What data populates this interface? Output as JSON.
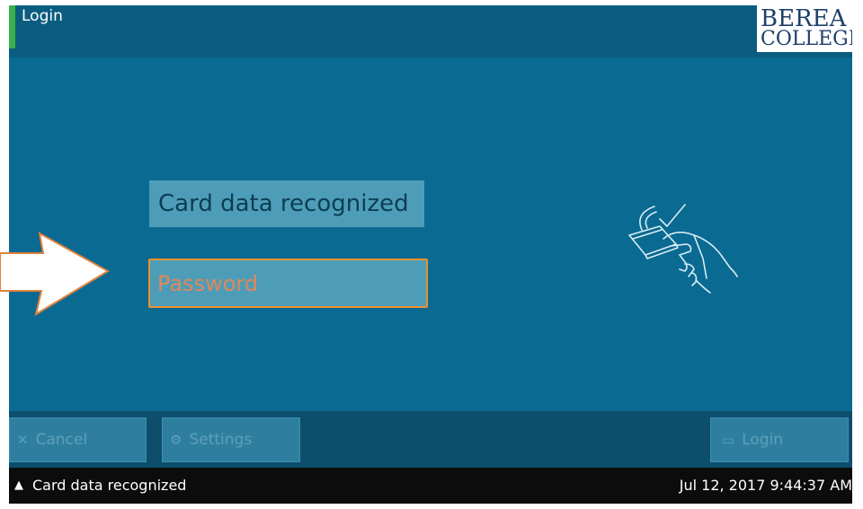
{
  "window": {
    "title": "Login",
    "logo_line1": "BEREA",
    "logo_line2": "COLLEGE"
  },
  "form": {
    "card_status": "Card data recognized",
    "password": {
      "placeholder": "Password",
      "value": ""
    }
  },
  "buttons": {
    "cancel": "Cancel",
    "settings": "Settings",
    "login": "Login"
  },
  "status": {
    "message": "Card data recognized",
    "datetime": "Jul 12, 2017 9:44:37 AM"
  },
  "icons": {
    "cancel": "close-icon",
    "settings": "gear-icon",
    "login": "login-icon",
    "status": "warning-triangle-icon",
    "illustration": "card-swipe-icon"
  },
  "colors": {
    "accent_green": "#36b24a",
    "focus_orange": "#f0902c",
    "background": "#0a6a92"
  }
}
